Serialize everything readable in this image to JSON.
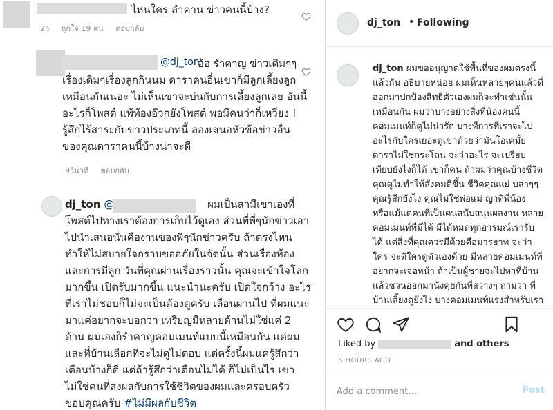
{
  "comments": [
    {
      "text": "ไหนใคร ลำคาน ข่าวคนนี้บ้าง?",
      "age": "2ว",
      "likes": "ถูกใจ 19 คน",
      "reply": "ตอบกลับ"
    },
    {
      "mention": "@dj_ton",
      "text": "อ้อ รำคาญ ข่าวเดิมๆๆ เรื่องเดิมๆเรื่องลูกกินนม ดาราคนอื่นเขาก็มีลูกเลี้ยงลูกเหมือนกันเนอะ ไม่เห็นเขาจะบ่นกับการเลี้ยงลูกเลย อันนี้อะไรก็โพสต์ แพ้ท้องอ๊วกยังโพสต์ พอมีคนว่าก็เหวี่ยง ! รู้สึกไร้สาระกับข่าวประเภทนี้ ลองเสนอหัวข้อข่าวอื่น ของคุณดาราคนนี้บ้างน่าจะดี",
      "age": "9วินาที",
      "reply": "ตอบกลับ"
    },
    {
      "username": "dj_ton",
      "mention": "@",
      "text": "ผมเป็นสามีเขาเองที่โพสต์ไปทางเราต้องการเก็บไว้ดูเอง ส่วนที่พี่ๆนักข่าวเอาไปนำเสนอนั่นคืองานของพี่ๆนักข่าวครับ ถ้าตรงไหนทำให้ไม่สบายใจกราบขออภัยในจัดนั้น ส่วนเรื่องท้องและการมีลูก วันที่คุณผ่านเรื่องราวนั้น คุณจะเข้าใจโลกมากขึ้น เปิดรับมากขึ้น แนะนำนะครับ เปิดใจกว้าง อะไรที่เราไม่ชอบก็ไม่จะเป็นต้องดูครับ เลื่อนผ่านไป ที่ผมแนะมาแค่อยากจะบอกว่า เหรียญมีหลายด้านไม่ใช่แค่ 2 ด้าน ผมเองก็รำคาญคอมเมนท์แบบนี้เหมือนกัน แต่ผมและที่บ้านเลือกที่จะไม่ดูไม่ตอบ แต่ครั้งนี้ผมแค่รู้สึกว่าเตือนบ้างก็ดี แต่ถ้ารู้สึกว่าเตือนไม่ได้ ก็ไม่เป็นไร เขาไม่ใช่คนที่ส่งผลกับการใช้ชีวิตของผมและครอบครัว ขอบคุณครับ",
      "hashtag": "#ไม่มีผลกับชีวิต"
    }
  ],
  "post": {
    "username": "dj_ton",
    "dot": "•",
    "following": "Following",
    "caption_user": "dj_ton",
    "caption": "ผมขออนุญาตใช้พื้นที่ของผมตรงนี้แล้วกัน อธิบายหน่อย ผมเห็นหลายๆคนแล้วที่ออกมาปกป้องสิทธิตัวเองผมก็จะทำเช่นนั้นเหมือนกัน ผมว่าบางอย่างสิ่งที่น้องคนนี้คอมเมนท์ก็ดูไม่น่ารัก บางทีการที่เราจะไปอะไรกับใครเยอะดูเขาด้วยว่ามันโอเคมั้ย ดาราไม่ใช่กระโถน จะว่าอะไร จะเปรียบเทียบยังไงก็ได้ เขาก็คน ถ้าผมว่าคุณบ้างชีวิตคุณดูไม่ทำให้สังคมดีขึ้น ชีวิตคุณแย่ บลาๆๆ คุณรู้สึกยังไง คุณไม่ใช่พ่อแม่ ญาติพี่น้อง หรือแม้แต่คนที่เป็นคนสนับสนุนผลงาน หลายคอมเมนท์ที่มีได้ มีได้หมดทุกอารมณ์เรารับได้ แต่สิ่งที่คุณควรมีด้วยคือมารยาท จะว่าใคร จะติใครดูตัวเองด้วย มีหลายคอมเมนท์ที่อยากจะเจอหน้า ถ้าเป็นผู้ชายจะไปหาที่บ้านแล้วชวนออกมานั่งคุยกันที่สว่างๆ ถามว่า ที่บ้านเลี้ยงดูยังไง บางคอมเมนท์แรงสำหรับเรานะ เราไม่อยากให้ภรรยาต้องมานั่งอ่านอะไรพวกนี้ จิตตกเปล่าๆ เอาเวลาไปเล่นกับลูก ดีกว่า วันนี้ขอ",
    "liked_by": "Liked by",
    "and_others": "and others",
    "time_ago": "6 HOURS AGO",
    "comment_placeholder": "Add a comment…",
    "post_button": "Post"
  },
  "icons": {
    "heart": "heart-icon",
    "comment": "comment-icon",
    "share": "share-icon",
    "save": "bookmark-icon"
  }
}
